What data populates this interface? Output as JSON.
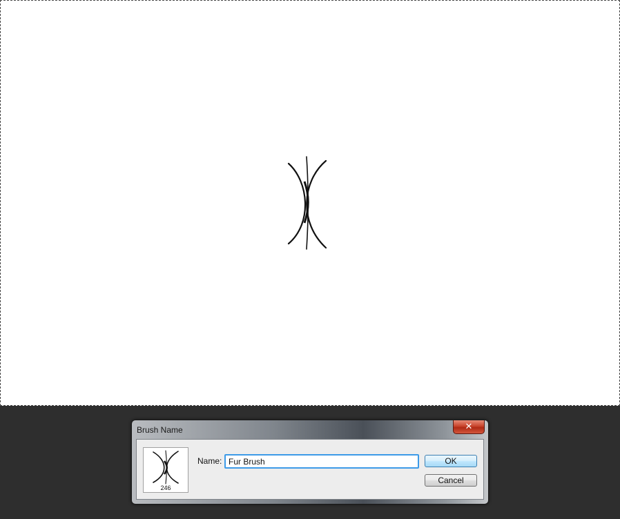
{
  "dialog": {
    "title": "Brush Name",
    "close_label": "✕",
    "brush_size": "246",
    "name_label": "Name:",
    "name_value": "Fur Brush",
    "ok_label": "OK",
    "cancel_label": "Cancel"
  },
  "colors": {
    "canvas": "#ffffff",
    "workspace": "#2e2e2e",
    "input_focus": "#3c9ae8",
    "close_button": "#c8442c"
  }
}
